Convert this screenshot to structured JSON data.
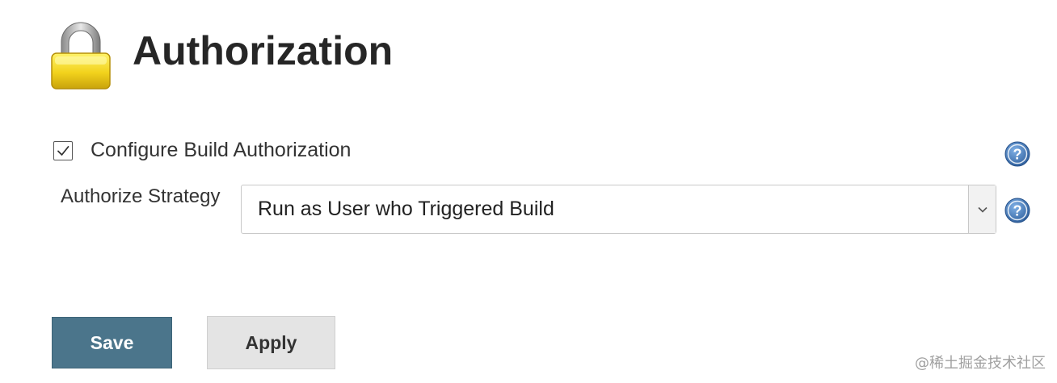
{
  "header": {
    "title": "Authorization",
    "icon": "lock-icon"
  },
  "configure_build_authorization": {
    "label": "Configure Build Authorization",
    "checked": true
  },
  "authorize_strategy": {
    "label": "Authorize Strategy",
    "selected": "Run as User who Triggered Build"
  },
  "buttons": {
    "save_label": "Save",
    "apply_label": "Apply"
  },
  "watermark": "@稀土掘金技术社区",
  "colors": {
    "save_button": "#4b758b",
    "apply_button": "#e4e4e4",
    "help_icon": "#3d6ea8",
    "lock_body": "#f2d21c"
  }
}
